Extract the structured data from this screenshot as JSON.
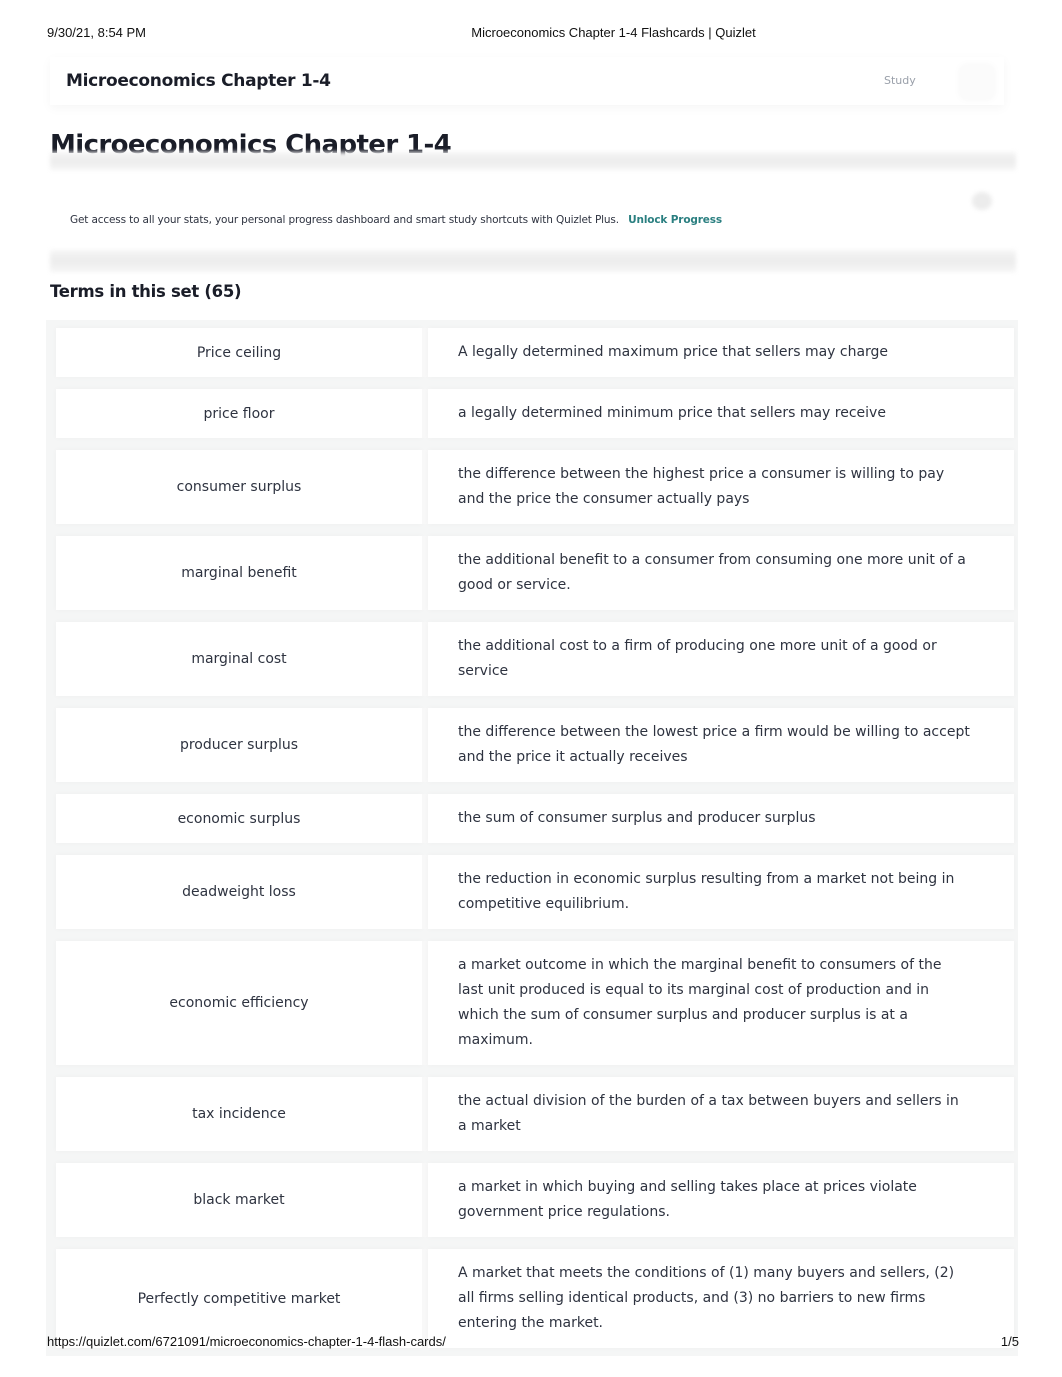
{
  "print_header": {
    "datetime": "9/30/21, 8:54 PM",
    "document_title": "Microeconomics Chapter 1-4 Flashcards | Quizlet"
  },
  "topbar": {
    "set_title": "Microeconomics Chapter 1-4",
    "study_label": "Study",
    "menu_icon": "more-options-icon"
  },
  "page": {
    "title": "Microeconomics Chapter 1-4",
    "promo_text": "Get access to all your stats, your personal progress dashboard and smart study shortcuts with Quizlet Plus.",
    "promo_link": "Unlock Progress",
    "accent_color": "#2a7f80",
    "terms_heading": "Terms in this set (65)"
  },
  "terms": [
    {
      "term": "Price ceiling",
      "definition": "A legally determined maximum price that sellers may charge"
    },
    {
      "term": "price floor",
      "definition": "a legally determined minimum price that sellers may receive"
    },
    {
      "term": "consumer surplus",
      "definition": "the difference between the highest price a consumer is willing to pay and the price the consumer actually pays"
    },
    {
      "term": "marginal benefit",
      "definition": "the additional benefit to a consumer from consuming one more unit of a good or service."
    },
    {
      "term": "marginal cost",
      "definition": "the additional cost to a firm of producing one more unit of a good or service"
    },
    {
      "term": "producer surplus",
      "definition": "the difference between the lowest price a firm would be willing to accept and the price it actually receives"
    },
    {
      "term": "economic surplus",
      "definition": "the sum of consumer surplus and producer surplus"
    },
    {
      "term": "deadweight loss",
      "definition": "the reduction in economic surplus resulting from a market not being in competitive equilibrium."
    },
    {
      "term": "economic efficiency",
      "definition": "a market outcome in which the marginal benefit to consumers of the last unit produced is equal to its marginal cost of production and in which the sum of consumer surplus and producer surplus is at a maximum."
    },
    {
      "term": "tax incidence",
      "definition": "the actual division of the burden of a tax between buyers and sellers in a market"
    },
    {
      "term": "black market",
      "definition": "a market in which buying and selling takes place at prices violate government price regulations."
    },
    {
      "term": "Perfectly competitive market",
      "definition": "A market that meets the conditions of (1) many buyers and sellers, (2) all firms selling identical products, and (3) no barriers to new firms entering the market."
    }
  ],
  "print_footer": {
    "url": "https://quizlet.com/6721091/microeconomics-chapter-1-4-flash-cards/",
    "page_indicator": "1/5"
  }
}
